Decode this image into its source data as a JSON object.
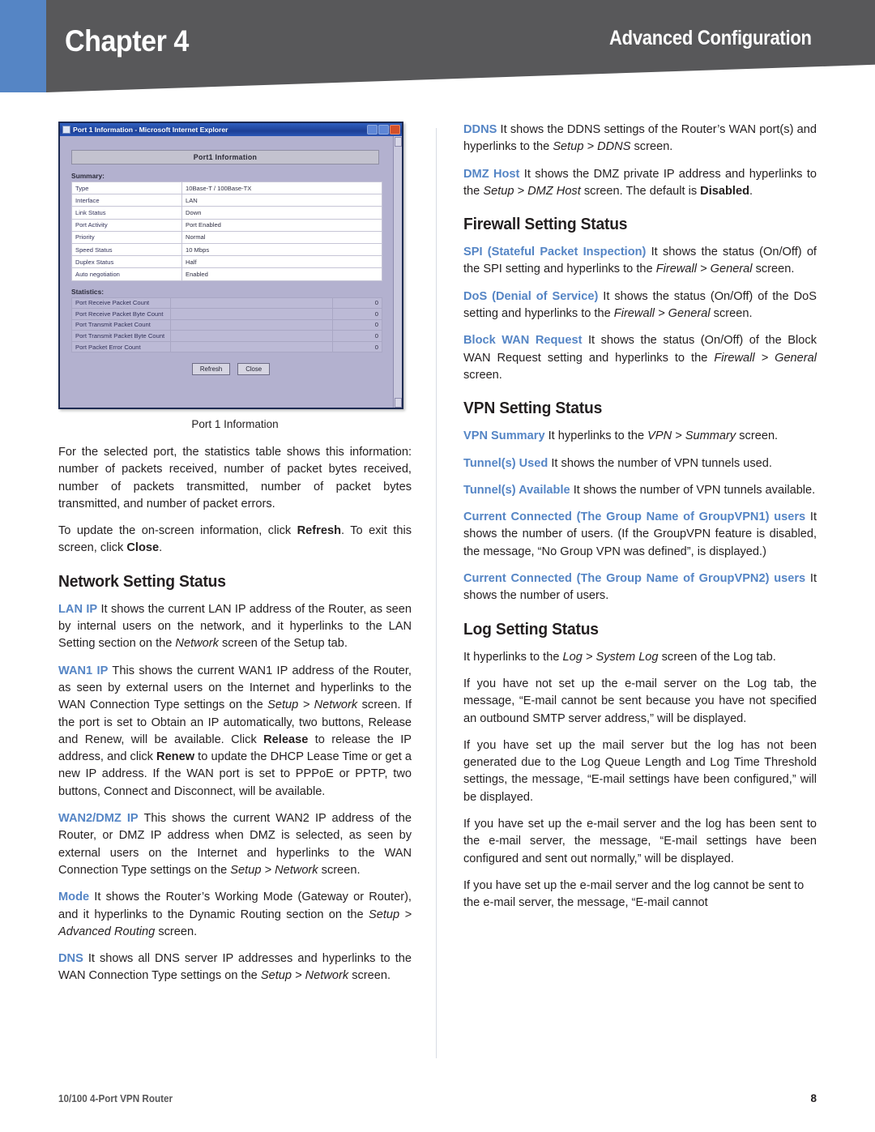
{
  "header": {
    "chapter": "Chapter 4",
    "section": "Advanced Configuration",
    "blue_bar_color": "#5585c5",
    "dark_color": "#58585a"
  },
  "accent_color": "#5585c5",
  "figure": {
    "caption": "Port 1 Information",
    "window_title": "Port 1 Information - Microsoft Internet Explorer",
    "panel_header": "Port1 Information",
    "summary_label": "Summary:",
    "summary_rows": [
      {
        "key": "Type",
        "value": "10Base-T / 100Base-TX"
      },
      {
        "key": "Interface",
        "value": "LAN"
      },
      {
        "key": "Link Status",
        "value": "Down"
      },
      {
        "key": "Port Activity",
        "value": "Port Enabled"
      },
      {
        "key": "Priority",
        "value": "Normal"
      },
      {
        "key": "Speed Status",
        "value": "10 Mbps"
      },
      {
        "key": "Duplex Status",
        "value": "Half"
      },
      {
        "key": "Auto negotiation",
        "value": "Enabled"
      }
    ],
    "statistics_label": "Statistics:",
    "statistics_rows": [
      {
        "key": "Port Receive Packet Count",
        "value": "0"
      },
      {
        "key": "Port Receive Packet Byte Count",
        "value": "0"
      },
      {
        "key": "Port Transmit Packet Count",
        "value": "0"
      },
      {
        "key": "Port Transmit Packet Byte Count",
        "value": "0"
      },
      {
        "key": "Port Packet Error Count",
        "value": "0"
      }
    ],
    "buttons": {
      "refresh": "Refresh",
      "close": "Close"
    }
  },
  "left_column": {
    "para_stats": {
      "text": "For the selected port, the statistics table shows this information: number of packets received, number of packet bytes received, number of packets transmitted, number of packet bytes transmitted, and number of packet errors."
    },
    "para_update": {
      "before_refresh": "To update the on-screen information, click ",
      "refresh": "Refresh",
      "between": ". To exit this screen, click ",
      "close": "Close",
      "after": "."
    },
    "heading_network": "Network Setting Status",
    "lan_ip": {
      "term": "LAN IP",
      "t1": "  It shows the current LAN IP address of the Router, as seen by internal users on the network, and it hyperlinks to the LAN Setting section on the ",
      "i1": "Network",
      "t2": " screen of the Setup tab."
    },
    "wan1_ip": {
      "term": "WAN1 IP",
      "t1": " This shows the current WAN1 IP address of the Router, as seen by external users on the Internet and hyperlinks to the WAN Connection Type settings on the ",
      "i1": "Setup > Network",
      "t2": " screen. If the port is set to Obtain an IP automatically, two buttons, Release and Renew, will be available. Click ",
      "b1": "Release",
      "t3": " to release the IP address, and click ",
      "b2": "Renew",
      "t4": " to update the DHCP Lease Time or get a new IP address. If the WAN port is set to PPPoE or PPTP, two buttons, Connect and Disconnect, will be available."
    },
    "wan2_dmz_ip": {
      "term": "WAN2/DMZ IP",
      "t1": "  This shows the current WAN2 IP address of the Router, or DMZ IP address when DMZ is selected, as seen by external users on the Internet and hyperlinks to the WAN Connection Type settings on the ",
      "i1": "Setup > Network",
      "t2": " screen."
    },
    "mode": {
      "term": "Mode",
      "t1": "  It shows the Router’s Working Mode (Gateway or Router), and it hyperlinks to the Dynamic Routing section on the ",
      "i1": "Setup > Advanced Routing",
      "t2": " screen."
    },
    "dns": {
      "term": "DNS",
      "t1": "  It shows all DNS server IP addresses and hyperlinks to the WAN Connection Type settings on the ",
      "i1": "Setup > Network",
      "t2": " screen."
    }
  },
  "right_column": {
    "ddns": {
      "term": "DDNS",
      "t1": "  It shows the DDNS settings of the Router’s WAN port(s) and hyperlinks to the ",
      "i1": "Setup > DDNS",
      "t2": " screen."
    },
    "dmz_host": {
      "term": "DMZ Host",
      "t1": " It shows the DMZ private IP address and hyperlinks to the ",
      "i1": "Setup > DMZ Host",
      "t2": " screen. The default is ",
      "b1": "Disabled",
      "t3": "."
    },
    "heading_firewall": "Firewall Setting Status",
    "spi": {
      "term": "SPI (Stateful Packet Inspection)",
      "t1": " It shows the status (On/Off) of the SPI setting and hyperlinks to the ",
      "i1": "Firewall > General",
      "t2": " screen."
    },
    "dos": {
      "term": "DoS (Denial of Service)",
      "t1": "  It shows the status (On/Off) of the DoS setting and hyperlinks to the ",
      "i1": "Firewall > General",
      "t2": " screen."
    },
    "block_wan": {
      "term": "Block WAN Request",
      "t1": " It shows the status (On/Off) of the Block WAN Request setting and hyperlinks to the ",
      "i1": "Firewall > General",
      "t2": " screen."
    },
    "heading_vpn": "VPN Setting Status",
    "vpn_summary": {
      "term": "VPN Summary",
      "t1": " It hyperlinks to the ",
      "i1": "VPN > Summary",
      "t2": " screen."
    },
    "tunnels_used": {
      "term": "Tunnel(s) Used",
      "t1": " It shows the number of VPN tunnels used."
    },
    "tunnels_available": {
      "term": "Tunnel(s) Available",
      "t1": "  It shows the number of VPN tunnels available."
    },
    "group_vpn1": {
      "term": "Current Connected (The Group Name of GroupVPN1) users",
      "t1": "  It shows the number of users. (If the GroupVPN feature is disabled, the message, “No Group VPN was defined”, is displayed.)"
    },
    "group_vpn2": {
      "term": "Current Connected (The Group Name of GroupVPN2) users",
      "t1": "  It shows the number of users."
    },
    "heading_log": "Log Setting Status",
    "log_hyperlink": {
      "t1": "It hyperlinks to the ",
      "i1": "Log > System Log",
      "t2": " screen of the Log tab."
    },
    "log_no_server": "If you have not set up the e-mail server on the Log tab, the message, “E-mail cannot be sent because you have not specified an outbound SMTP server address,” will be displayed.",
    "log_not_generated": "If you have set up the mail server but the log has not been generated due to the Log Queue Length and Log Time Threshold settings, the message, “E-mail settings have been configured,” will be displayed.",
    "log_sent": "If you have set up the e-mail server and the log has been sent to the e-mail server, the message, “E-mail settings have been configured and sent out normally,” will be displayed.",
    "log_cannot": "If you have set up the e-mail server and the log cannot be sent to the e-mail server, the message, “E-mail cannot"
  },
  "footer": {
    "left": "10/100 4-Port VPN Router",
    "page": "8"
  }
}
